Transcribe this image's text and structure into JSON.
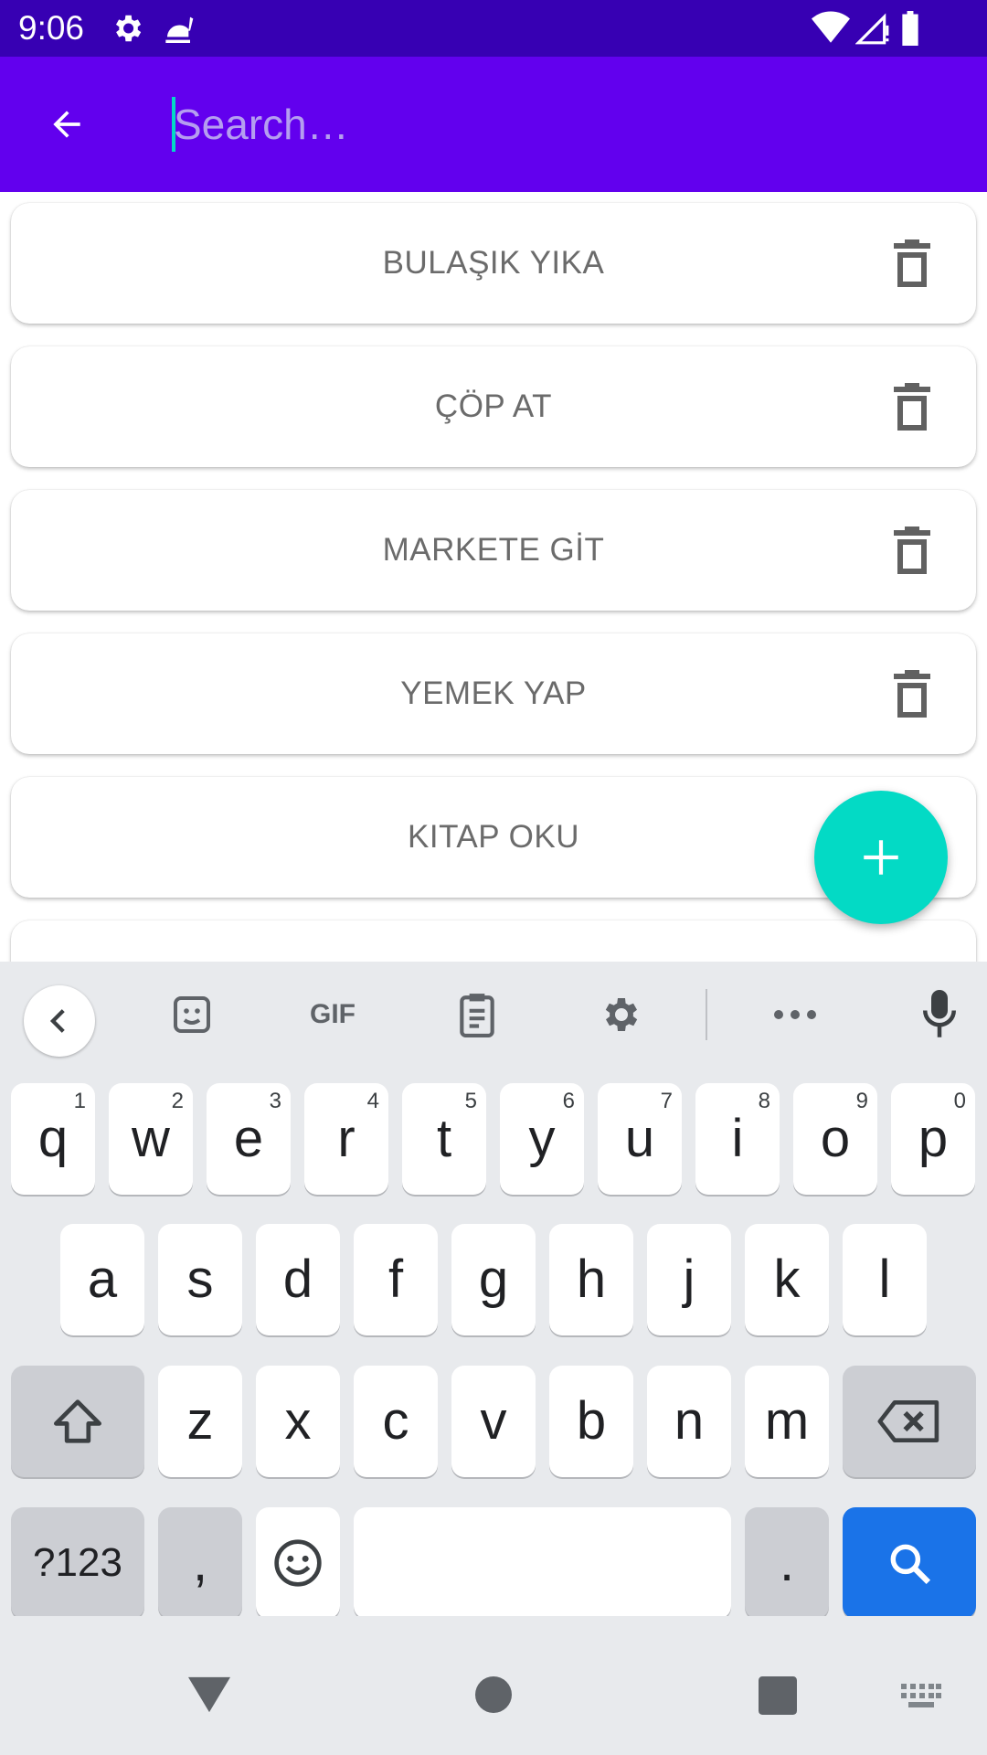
{
  "status_bar": {
    "time": "9:06",
    "icons_left": [
      "gear-icon",
      "restaurant-icon"
    ],
    "icons_right": [
      "wifi-icon",
      "signal-icon",
      "battery-icon"
    ]
  },
  "app_bar": {
    "back_icon": "arrow-back-icon",
    "search_placeholder": "Search…",
    "search_value": ""
  },
  "tasks": [
    {
      "label": "BULAŞIK YIKA"
    },
    {
      "label": "ÇÖP AT"
    },
    {
      "label": "MARKETE GİT"
    },
    {
      "label": "YEMEK YAP"
    },
    {
      "label": "KITAP OKU"
    }
  ],
  "fab": {
    "icon": "plus-icon"
  },
  "keyboard": {
    "toolbar": [
      "chevron-left-icon",
      "sticker-icon",
      "gif-icon",
      "clipboard-icon",
      "settings-icon",
      "more-icon",
      "mic-icon"
    ],
    "gif_label": "GIF",
    "row1": [
      {
        "k": "q",
        "n": "1"
      },
      {
        "k": "w",
        "n": "2"
      },
      {
        "k": "e",
        "n": "3"
      },
      {
        "k": "r",
        "n": "4"
      },
      {
        "k": "t",
        "n": "5"
      },
      {
        "k": "y",
        "n": "6"
      },
      {
        "k": "u",
        "n": "7"
      },
      {
        "k": "i",
        "n": "8"
      },
      {
        "k": "o",
        "n": "9"
      },
      {
        "k": "p",
        "n": "0"
      }
    ],
    "row2": [
      "a",
      "s",
      "d",
      "f",
      "g",
      "h",
      "j",
      "k",
      "l"
    ],
    "row3": [
      "z",
      "x",
      "c",
      "v",
      "b",
      "n",
      "m"
    ],
    "symbols_label": "?123",
    "comma_label": ",",
    "period_label": ".",
    "search_key_color": "#1a73e8"
  },
  "colors": {
    "status_bar": "#3700b3",
    "app_bar": "#6200ee",
    "fab": "#03dac5",
    "accent_cursor": "#03dac5"
  }
}
